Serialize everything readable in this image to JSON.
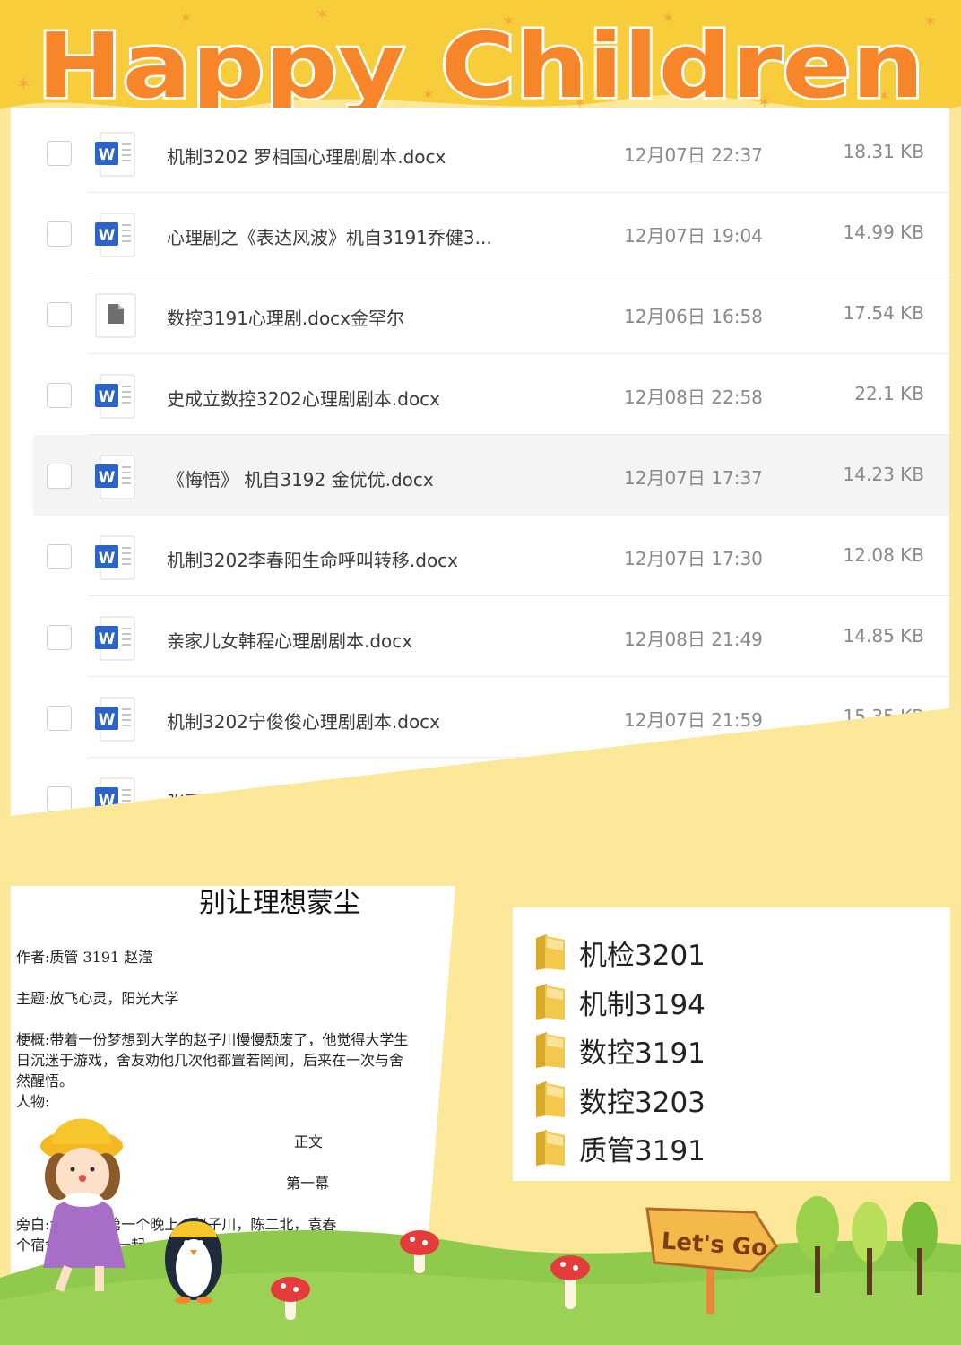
{
  "banner": {
    "title": "Happy Children"
  },
  "files": [
    {
      "name": "机制3202 罗相国心理剧剧本.docx",
      "date": "12月07日 22:37",
      "size": "18.31 KB",
      "icon": "word-icon"
    },
    {
      "name": "心理剧之《表达风波》机自3191乔健3...",
      "date": "12月07日 19:04",
      "size": "14.99 KB",
      "icon": "word-icon"
    },
    {
      "name": "数控3191心理剧.docx金罕尔",
      "date": "12月06日 16:58",
      "size": "17.54 KB",
      "icon": "generic-file-icon"
    },
    {
      "name": "史成立数控3202心理剧剧本.docx",
      "date": "12月08日 22:58",
      "size": "22.1 KB",
      "icon": "word-icon"
    },
    {
      "name": "《悔悟》 机自3192 金优优.docx",
      "date": "12月07日 17:37",
      "size": "14.23 KB",
      "icon": "word-icon"
    },
    {
      "name": "机制3202李春阳生命呼叫转移.docx",
      "date": "12月07日 17:30",
      "size": "12.08 KB",
      "icon": "word-icon"
    },
    {
      "name": "亲家儿女韩程心理剧剧本.docx",
      "date": "12月08日 21:49",
      "size": "14.85 KB",
      "icon": "word-icon"
    },
    {
      "name": "机制3202宁俊俊心理剧剧本.docx",
      "date": "12月07日 21:59",
      "size": "15.35 KB",
      "icon": "word-icon"
    },
    {
      "name": "张磊",
      "date": "",
      "size": "",
      "icon": "word-icon"
    }
  ],
  "document": {
    "title": "别让理想蒙尘",
    "author": "作者:质管 3191 赵滢",
    "theme": "主题:放飞心灵，阳光大学",
    "summary_1": "梗概:带着一份梦想到大学的赵子川慢慢颓废了，他觉得大学生",
    "summary_2": "日沉迷于游戏，舍友劝他几次他都置若罔闻，后来在一次与舍",
    "summary_3": "然醒悟。",
    "characters": "人物:",
    "body_label": "正文",
    "act": "第一幕",
    "narration_1": "旁白:大学到的第一个晚上，赵子川，陈二北，袁春",
    "narration_2": "个宿舍，他们在一起"
  },
  "folders": [
    "机检3201",
    "机制3194",
    "数控3191",
    "数控3203",
    "质管3191"
  ],
  "scene": {
    "sign": "Let's Go"
  },
  "colors": {
    "banner": "#f7cd3c",
    "title_fill": "#f7862a",
    "background": "#fde89a",
    "grass": "#8fca4c",
    "word_blue": "#2b64c6",
    "folder": "#f2c94c"
  }
}
